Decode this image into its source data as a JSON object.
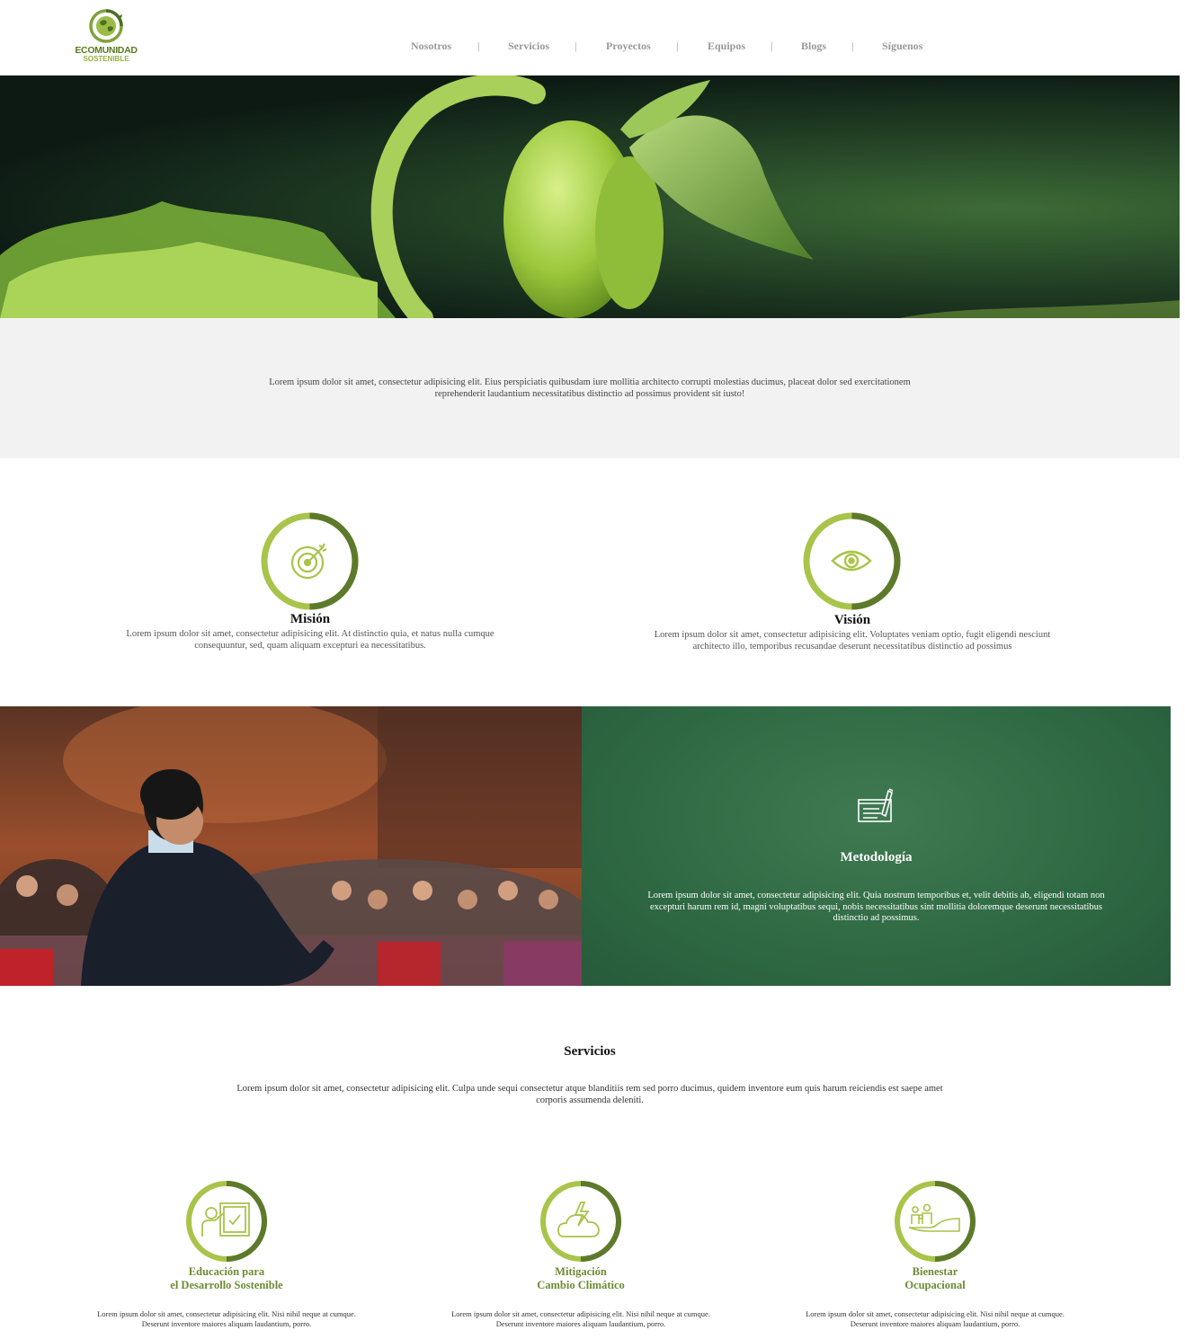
{
  "header": {
    "logo_line1": "ECOMUNIDAD",
    "logo_line2": "SOSTENIBLE",
    "nav": [
      "Nosotros",
      "Servicios",
      "Proyectos",
      "Equipos",
      "Blogs",
      "Síguenos"
    ],
    "separator": "|"
  },
  "intro": {
    "text": "Lorem ipsum dolor sit amet, consectetur adipisicing elit. Eius perspiciatis quibusdam iure mollitia architecto corrupti molestias ducimus, placeat dolor sed exercitationem reprehenderit laudantium necessitatibus distinctio ad possimus provident sit iusto!"
  },
  "mission": {
    "title": "Misión",
    "text": "Lorem ipsum dolor sit amet, consectetur adipisicing elit. At distinctio quia, et natus nulla cumque consequuntur, sed, quam aliquam excepturi ea necessitatibus.",
    "icon": "target-icon"
  },
  "vision": {
    "title": "Visión",
    "text": "Lorem ipsum dolor sit amet, consectetur adipisicing elit. Voluptates veniam optio, fugit eligendi nesciunt architecto illo, temporibus recusandae deserunt necessitatibus distinctio ad possimus",
    "icon": "eye-icon"
  },
  "methodology": {
    "title": "Metodología",
    "text": "Lorem ipsum dolor sit amet, consectetur adipisicing elit. Quia nostrum temporibus et, velit debitis ab, eligendi totam non excepturi harum rem id, magni voluptatibus sequi, nobis necessitatibus sint mollitia doloremque deserunt necessitatibus distinctio ad possimus.",
    "icon": "writing-pad-icon"
  },
  "services": {
    "title": "Servicios",
    "text": "Lorem ipsum dolor sit amet, consectetur adipisicing elit. Culpa unde sequi consectetur atque blanditiis rem sed porro ducimus, quidem inventore eum quis harum reiciendis est saepe amet corporis assumenda deleniti.",
    "items": [
      {
        "line1": "Educación para",
        "line2": "el Desarrollo Sostenible",
        "text": "Lorem ipsum dolor sit amet, consectetur adipisicing elit. Nisi nihil neque at cumque. Deserunt inventore maiores aliquam laudantium, porro.",
        "icon": "teacher-board-icon"
      },
      {
        "line1": "Mitigación",
        "line2": "Cambio Climático",
        "text": "Lorem ipsum dolor sit amet, consectetur adipisicing elit. Nisi nihil neque at cumque. Deserunt inventore maiores aliquam laudantium, porro.",
        "icon": "storm-cloud-icon"
      },
      {
        "line1": "Bienestar",
        "line2": "Ocupacional",
        "text": "Lorem ipsum dolor sit amet, consectetur adipisicing elit. Nisi nihil neque at cumque. Deserunt inventore maiores aliquam laudantium, porro.",
        "icon": "family-hand-icon"
      }
    ]
  },
  "colors": {
    "accent_light": "#a8c44a",
    "accent_dark": "#5d7a2c",
    "method_green": "#2f6a44",
    "band_gray": "#f2f2f2"
  }
}
